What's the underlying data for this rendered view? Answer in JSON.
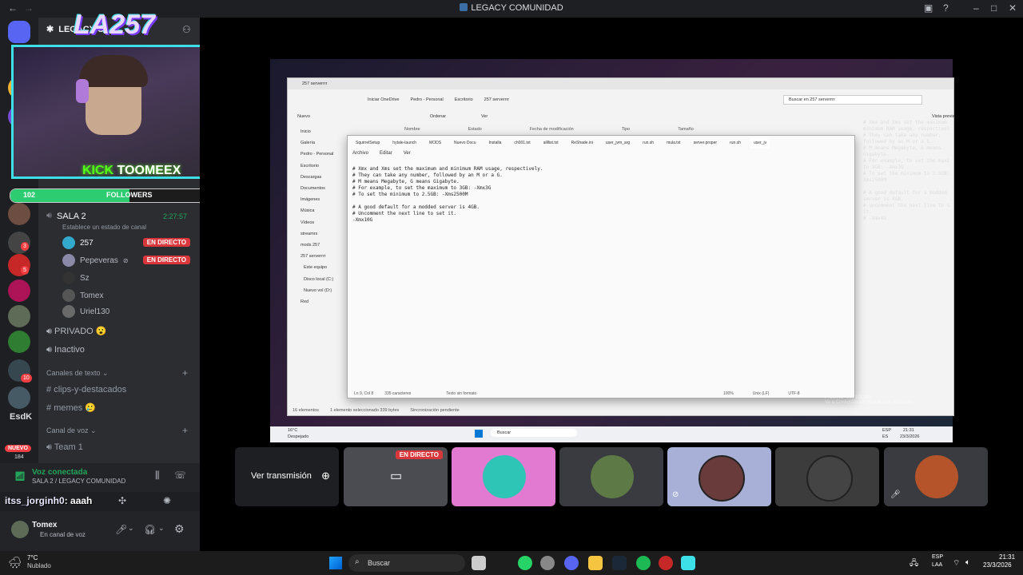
{
  "window": {
    "title": "LEGACY COMUNIDAD"
  },
  "server": {
    "name": "LEGACY C"
  },
  "rail": {
    "badges": [
      "3",
      "5",
      "10"
    ],
    "label": "EsdK",
    "new_badge": "NUEVO",
    "new_count": "184"
  },
  "stream_overlay": {
    "brand": "LA257",
    "kick_label": "KICK",
    "kick_user": "TOOMEEX",
    "kick_badge": "K 3",
    "followers_label": "FOLLOWERS",
    "followers_current": "102",
    "followers_goal": "200",
    "followers_fraction": 0.51
  },
  "channel": {
    "name": "SALA 2",
    "time": "2:27:57",
    "status": "Establece un estado de canal"
  },
  "users": [
    {
      "name": "257",
      "live": "EN DIRECTO"
    },
    {
      "name": "Pepeveras",
      "live": "EN DIRECTO"
    },
    {
      "name": "Sz",
      "live": ""
    },
    {
      "name": "Tomex",
      "live": ""
    },
    {
      "name": "Uriel130",
      "live": ""
    }
  ],
  "voice_channels": {
    "privado": "PRIVADO 😮",
    "inactivo": "Inactivo"
  },
  "categories": {
    "text": "Canales de texto",
    "voice": "Canal de voz"
  },
  "text_channels": [
    "clips-y-destacados",
    "memes 🥲"
  ],
  "voice_list": [
    "Team 1"
  ],
  "voice_status": {
    "title": "Voz conectada",
    "subtitle": "SALA 2 / LEGACY COMUNIDAD"
  },
  "chat_overlay": {
    "user": "itss_jorginh0",
    "message": ": aaah"
  },
  "self_user": {
    "name": "Tomex",
    "status": "En canal de voz"
  },
  "share_button": "Ver transmisión",
  "tile_live": "EN DIRECTO",
  "explorer": {
    "title": "257 serverrrr",
    "breadcrumb": [
      "Iniciar OneDrive",
      "Pedro - Personal",
      "Escritorio",
      "257 serverrrr"
    ],
    "search": "Buscar en 257 serverrrr",
    "toolbar": [
      "Nuevo",
      "Ordenar",
      "Ver"
    ],
    "preview": "Vista previa",
    "columns": [
      "Nombre",
      "Estado",
      "Fecha de modificación",
      "Tipo",
      "Tamaño"
    ],
    "nav": [
      "Inicio",
      "Galería",
      "Pedro - Personal",
      "Escritorio",
      "Descargas",
      "Documentos",
      "Imágenes",
      "Música",
      "Vídeos",
      "streamrs",
      "mods 257",
      "257 serverrrr",
      "Este equipo",
      "Disco local (C:)",
      "Nuevo vol (D:)",
      "Red"
    ],
    "status": [
      "16 elementos",
      "1 elemento seleccionado 339 bytes",
      "Sincronización pendiente"
    ]
  },
  "notepad": {
    "tabs": [
      "SquirrelSetup",
      "hytale-launch",
      "MODS",
      "Nuevo Docu",
      "Installa",
      "ch001.txt",
      "allllist.txt",
      "ReShade.ini",
      "user_jvm_arg",
      "run.sh",
      "mula.txt",
      "server.proper",
      "run.sh",
      "user_jv"
    ],
    "menu": [
      "Archivo",
      "Editar",
      "Ver"
    ],
    "lines": [
      "# Xmx and Xms set the maximum and minimum RAM usage, respectively.",
      "# They can take any number, followed by an M or a G.",
      "# M means Megabyte, G means Gigabyte.",
      "# For example, to set the maximum to 3GB: -Xmx3G",
      "# To set the minimum to 2.5GB: -Xms2500M",
      "",
      "# A good default for a modded server is 4GB.",
      "# Uncomment the next line to set it.",
      "-Xmx10G"
    ],
    "status": [
      "Ln 9, Col 8",
      "335 caracteres",
      "Texto sin formato",
      "100%",
      "Unix (LF)",
      "UTF-8"
    ]
  },
  "side_text": [
    "# Xmx and Xms set the maximum",
    "minimum RAM usage, respectivel",
    "# They can take any number,",
    "followed by an M or a G.",
    "# M means Megabyte, G means",
    "Gigabyte.",
    "# For example, to set the maxi",
    "to 3GB: -Xmx3G",
    "# To set the minimum to 2.5GB:",
    "Xms2500M",
    "",
    "# A good default for a modded",
    "server is 4GB.",
    "# Uncomment the next line to s",
    "it.",
    "# -Xmx4G"
  ],
  "activate_windows": {
    "title": "Activar Windows",
    "subtitle": "Ve a Configuración para activar Windows."
  },
  "inner_taskbar": {
    "weather": "16°C",
    "weather_desc": "Despejado",
    "search": "Buscar",
    "lang": "ESP",
    "region": "ES",
    "time": "21:31",
    "date": "23/3/2026"
  },
  "taskbar": {
    "weather": "7°C",
    "weather_desc": "Nublado",
    "search": "Buscar",
    "lang": "ESP",
    "region": "LAA",
    "time": "21:31",
    "date": "23/3/2026"
  },
  "colors": {
    "live_red": "#da373c",
    "voice_green": "#23a55a",
    "cyan_border": "#3ee0e8"
  }
}
